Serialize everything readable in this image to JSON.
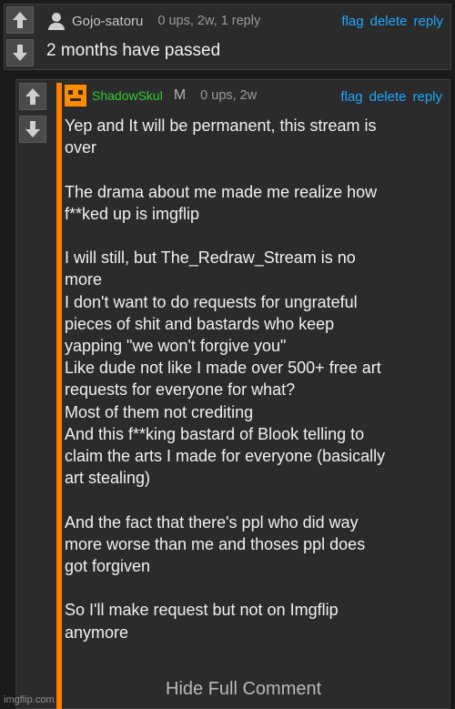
{
  "comment1": {
    "username": "Gojo-satoru",
    "meta": "0 ups, 2w, 1 reply",
    "actions": {
      "flag": "flag",
      "delete": "delete",
      "reply": "reply"
    },
    "text": "2 months have passed",
    "icons": {
      "upvote": "arrow-up-icon",
      "downvote": "arrow-down-icon",
      "avatar": "user-icon"
    }
  },
  "comment2": {
    "username": "ShadowSkul",
    "mod_badge": "M",
    "meta": "0 ups, 2w",
    "actions": {
      "flag": "flag",
      "delete": "delete",
      "reply": "reply"
    },
    "lines": [
      "Yep and It will be permanent, this stream is",
      "over",
      "",
      "The drama about me made me realize how",
      "f**ked up is imgflip",
      "",
      "I will still, but The_Redraw_Stream is no",
      "more",
      "I don't want to do requests for ungrateful",
      "pieces of shit and bastards who keep",
      "yapping \"we won't forgive you\"",
      "Like dude not like I made over 500+ free art",
      "requests for everyone for what?",
      "Most of them not crediting",
      "And this f**king bastard of Blook telling to",
      "claim the arts I made for everyone (basically",
      "art stealing)",
      "",
      "And the fact that there's ppl who did way",
      "more worse than me and thoses ppl does",
      "got forgiven",
      "",
      "So I'll make request but not on Imgflip",
      "anymore"
    ],
    "hide_label": "Hide Full Comment",
    "accent_color": "#ff8000",
    "username_color": "#38c738"
  },
  "watermark": "imgflip.com",
  "colors": {
    "link": "#1ea7ff",
    "background": "#1a1a1a",
    "panel": "#2b2b2b"
  }
}
